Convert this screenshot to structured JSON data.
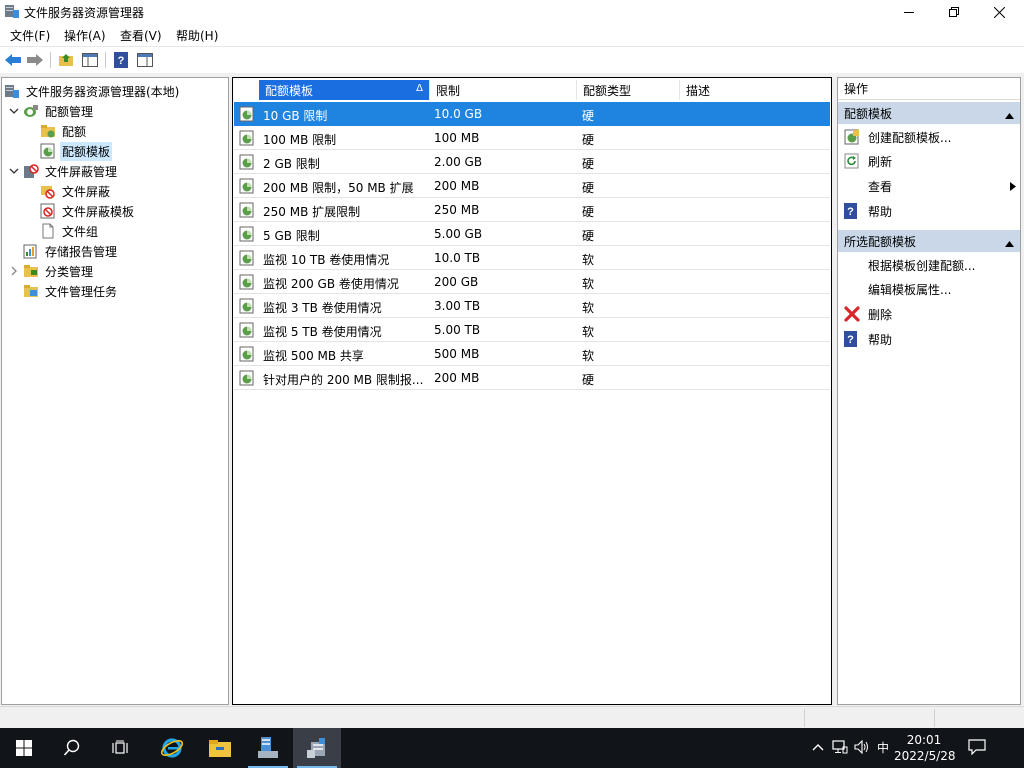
{
  "window": {
    "title": "文件服务器资源管理器"
  },
  "menu": [
    "文件(F)",
    "操作(A)",
    "查看(V)",
    "帮助(H)"
  ],
  "tree": {
    "root": "文件服务器资源管理器(本地)",
    "quota_mgmt": "配额管理",
    "quota": "配额",
    "quota_template": "配额模板",
    "screen_mgmt": "文件屏蔽管理",
    "file_screen": "文件屏蔽",
    "file_screen_template": "文件屏蔽模板",
    "file_group": "文件组",
    "storage_report": "存储报告管理",
    "classification": "分类管理",
    "file_tasks": "文件管理任务"
  },
  "list": {
    "columns": [
      "配额模板",
      "限制",
      "配额类型",
      "描述"
    ],
    "sort_arrow": "Δ",
    "rows": [
      {
        "name": "10 GB 限制",
        "limit": "10.0 GB",
        "type": "硬",
        "desc": ""
      },
      {
        "name": "100 MB 限制",
        "limit": "100 MB",
        "type": "硬",
        "desc": ""
      },
      {
        "name": "2 GB 限制",
        "limit": "2.00 GB",
        "type": "硬",
        "desc": ""
      },
      {
        "name": "200 MB 限制，50 MB 扩展",
        "limit": "200 MB",
        "type": "硬",
        "desc": ""
      },
      {
        "name": "250 MB 扩展限制",
        "limit": "250 MB",
        "type": "硬",
        "desc": ""
      },
      {
        "name": "5 GB 限制",
        "limit": "5.00 GB",
        "type": "硬",
        "desc": ""
      },
      {
        "name": "监视 10 TB 卷使用情况",
        "limit": "10.0 TB",
        "type": "软",
        "desc": ""
      },
      {
        "name": "监视 200 GB 卷使用情况",
        "limit": "200 GB",
        "type": "软",
        "desc": ""
      },
      {
        "name": "监视 3 TB 卷使用情况",
        "limit": "3.00 TB",
        "type": "软",
        "desc": ""
      },
      {
        "name": "监视 5 TB 卷使用情况",
        "limit": "5.00 TB",
        "type": "软",
        "desc": ""
      },
      {
        "name": "监视 500 MB 共享",
        "limit": "500 MB",
        "type": "软",
        "desc": ""
      },
      {
        "name": "针对用户的 200 MB 限制报...",
        "limit": "200 MB",
        "type": "硬",
        "desc": ""
      }
    ]
  },
  "actions": {
    "header": "操作",
    "section1": {
      "title": "配额模板",
      "items": [
        "创建配额模板...",
        "刷新",
        "查看",
        "帮助"
      ]
    },
    "section2": {
      "title": "所选配额模板",
      "items": [
        "根据模板创建配额...",
        "编辑模板属性...",
        "删除",
        "帮助"
      ]
    }
  },
  "taskbar": {
    "ime": "中",
    "time": "20:01",
    "date": "2022/5/28"
  },
  "colors": {
    "selection": "#1f84e0",
    "section_header": "#c9d7e8",
    "taskbar": "#111419"
  }
}
